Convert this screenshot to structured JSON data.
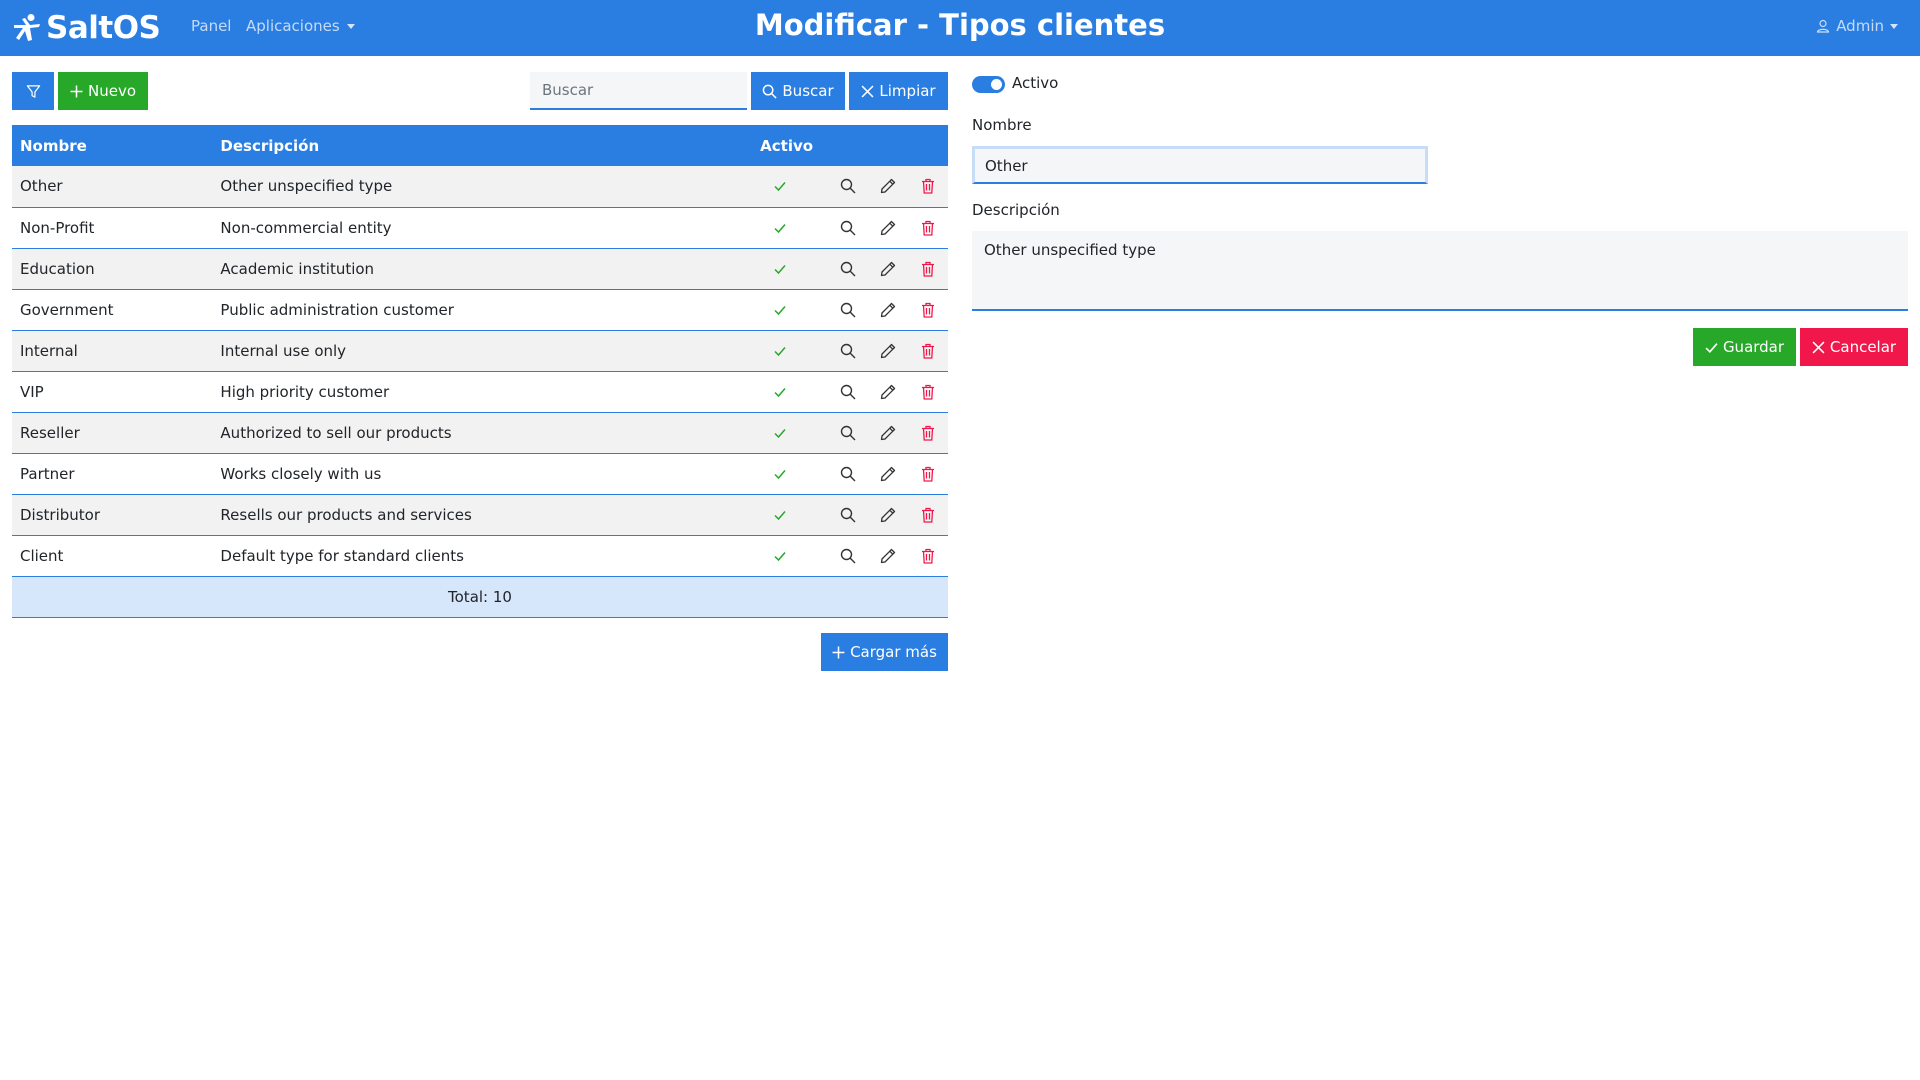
{
  "app": {
    "brand": "SaltOS",
    "title": "Modificar - Tipos clientes"
  },
  "nav": {
    "panel": "Panel",
    "apps": "Aplicaciones",
    "user": "Admin"
  },
  "toolbar": {
    "new_label": "Nuevo",
    "search_placeholder": "Buscar",
    "search_value": "",
    "search_label": "Buscar",
    "clear_label": "Limpiar",
    "load_more_label": "Cargar más"
  },
  "table": {
    "headers": {
      "name": "Nombre",
      "description": "Descripción",
      "active": "Activo"
    },
    "rows": [
      {
        "name": "Other",
        "description": "Other unspecified type",
        "active": true
      },
      {
        "name": "Non-Profit",
        "description": "Non-commercial entity",
        "active": true
      },
      {
        "name": "Education",
        "description": "Academic institution",
        "active": true
      },
      {
        "name": "Government",
        "description": "Public administration customer",
        "active": true
      },
      {
        "name": "Internal",
        "description": "Internal use only",
        "active": true
      },
      {
        "name": "VIP",
        "description": "High priority customer",
        "active": true
      },
      {
        "name": "Reseller",
        "description": "Authorized to sell our products",
        "active": true
      },
      {
        "name": "Partner",
        "description": "Works closely with us",
        "active": true
      },
      {
        "name": "Distributor",
        "description": "Resells our products and services",
        "active": true
      },
      {
        "name": "Client",
        "description": "Default type for standard clients",
        "active": true
      }
    ],
    "total": "Total: 10"
  },
  "form": {
    "active_label": "Activo",
    "active": true,
    "name_label": "Nombre",
    "name_value": "Other",
    "description_label": "Descripción",
    "description_value": "Other unspecified type",
    "save_label": "Guardar",
    "cancel_label": "Cancelar"
  },
  "colors": {
    "primary": "#2a7de1",
    "success": "#28a828",
    "danger": "#f2174a",
    "check": "#28a828"
  },
  "icons": {
    "row_actions": [
      "search-icon",
      "pencil-icon",
      "trash-icon"
    ]
  }
}
